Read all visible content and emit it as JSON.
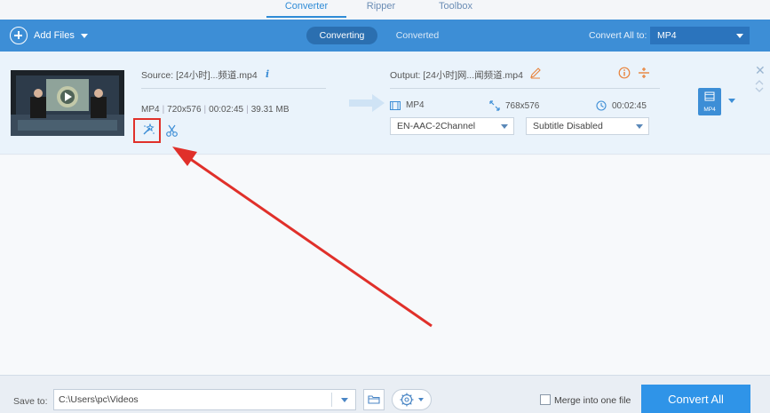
{
  "tabs": {
    "converter": "Converter",
    "ripper": "Ripper",
    "toolbox": "Toolbox"
  },
  "toolbar": {
    "add_files": "Add Files",
    "converting": "Converting",
    "converted": "Converted",
    "convert_all_to": "Convert All to:",
    "format": "MP4"
  },
  "file": {
    "source": "Source: [24小时]...频道.mp4",
    "container": "MP4",
    "resolution": "720x576",
    "duration": "00:02:45",
    "size": "39.31 MB",
    "output": "Output: [24小时]网...闻频道.mp4",
    "out_format": "MP4",
    "out_resolution": "768x576",
    "out_duration": "00:02:45",
    "audio_track": "EN-AAC-2Channel",
    "subtitle": "Subtitle Disabled",
    "badge_format": "MP4"
  },
  "bottom": {
    "save_to": "Save to:",
    "path": "C:\\Users\\pc\\Videos",
    "merge": "Merge into one file",
    "convert_all": "Convert All"
  },
  "colors": {
    "accent": "#3d8ed6",
    "highlight": "#e0302a"
  }
}
